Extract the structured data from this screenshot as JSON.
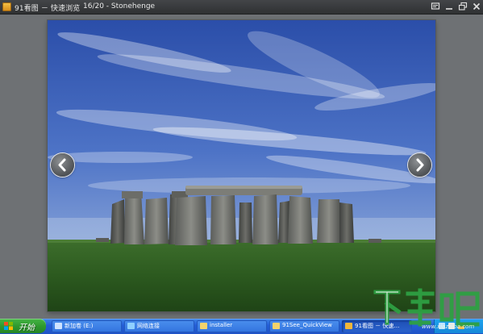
{
  "window": {
    "app_title": "91看图 － 快速浏览",
    "image_title": "16/20 - Stonehenge",
    "buttons": [
      "menu-icon",
      "minimize-icon",
      "maximize-icon",
      "close-icon"
    ]
  },
  "viewer": {
    "nav": [
      "chevron-left-icon",
      "chevron-right-icon"
    ]
  },
  "taskbar": {
    "start_label": "开始",
    "tasks": [
      {
        "label": "新加卷 (E:)",
        "icon": "drive-icon",
        "color": "#cfe3ff"
      },
      {
        "label": "网络连接",
        "icon": "network-icon",
        "color": "#8fd0ff"
      },
      {
        "label": "installer",
        "icon": "folder-icon",
        "color": "#f4d36b"
      },
      {
        "label": "91See_QuickView",
        "icon": "folder-icon",
        "color": "#f4d36b"
      },
      {
        "label": "91看图 － 快速…",
        "icon": "app-icon",
        "color": "#f2b63a"
      }
    ],
    "tray_icons": [
      "network-tray-icon",
      "volume-tray-icon",
      "app-tray-icon"
    ]
  },
  "watermark": {
    "logo_text": "下载吧",
    "url": "www.xiazaiba.com"
  },
  "colors": {
    "titlebar": "#3a3c3e",
    "background": "#6e7174",
    "taskbar": "#245ed6",
    "start_button": "#2f9a2f",
    "watermark": "#2ea043"
  }
}
